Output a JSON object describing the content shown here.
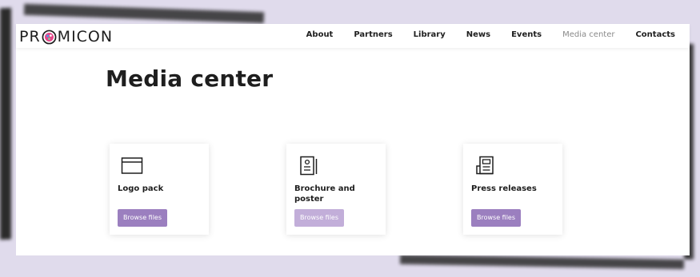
{
  "brand": {
    "logo_left": "PR",
    "logo_right": "MICON"
  },
  "nav": {
    "items": [
      {
        "label": "About",
        "active": false
      },
      {
        "label": "Partners",
        "active": false
      },
      {
        "label": "Library",
        "active": false
      },
      {
        "label": "News",
        "active": false
      },
      {
        "label": "Events",
        "active": false
      },
      {
        "label": "Media center",
        "active": true
      },
      {
        "label": "Contacts",
        "active": false
      }
    ]
  },
  "page": {
    "title": "Media center"
  },
  "cards": [
    {
      "title": "Logo pack",
      "button": "Browse files",
      "icon": "window-icon",
      "button_state": "normal"
    },
    {
      "title": "Brochure and poster",
      "button": "Browse files",
      "icon": "document-icon",
      "button_state": "faded"
    },
    {
      "title": "Press releases",
      "button": "Browse files",
      "icon": "newspaper-icon",
      "button_state": "normal"
    }
  ],
  "colors": {
    "accent": "#9b7fbf",
    "accent_faded": "#c2aed9",
    "background": "#e0dbec",
    "text": "#1e1e1e"
  }
}
